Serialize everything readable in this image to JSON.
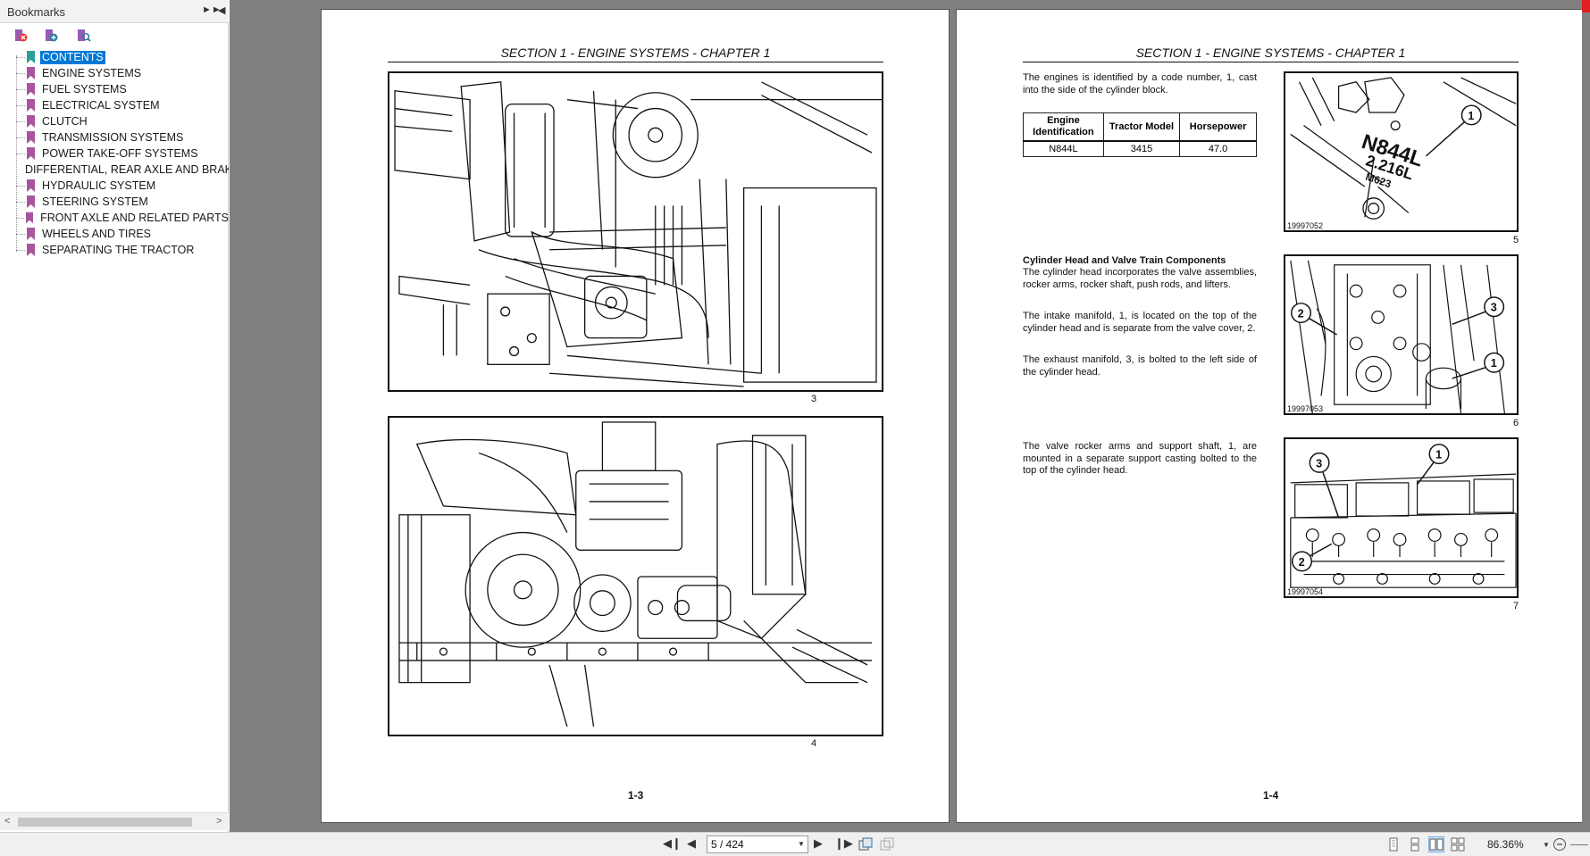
{
  "bookmarks_panel": {
    "title": "Bookmarks",
    "items": [
      {
        "label": "CONTENTS",
        "selected": true
      },
      {
        "label": "ENGINE SYSTEMS"
      },
      {
        "label": "FUEL SYSTEMS"
      },
      {
        "label": "ELECTRICAL SYSTEM"
      },
      {
        "label": "CLUTCH"
      },
      {
        "label": "TRANSMISSION SYSTEMS"
      },
      {
        "label": "POWER TAKE-OFF SYSTEMS"
      },
      {
        "label": "DIFFERENTIAL, REAR AXLE AND BRAK"
      },
      {
        "label": "HYDRAULIC SYSTEM"
      },
      {
        "label": "STEERING SYSTEM"
      },
      {
        "label": "FRONT AXLE AND RELATED PARTS"
      },
      {
        "label": "WHEELS AND TIRES"
      },
      {
        "label": "SEPARATING THE TRACTOR"
      }
    ]
  },
  "left_page": {
    "header": "SECTION 1 - ENGINE SYSTEMS - CHAPTER 1",
    "fig3_number": "3",
    "fig4_number": "4",
    "footer": "1-3"
  },
  "right_page": {
    "header": "SECTION 1 - ENGINE SYSTEMS - CHAPTER 1",
    "intro_text": "The engines is identified by a code number, 1, cast into the side of the cylinder block.",
    "table": {
      "headers": [
        "Engine Identification",
        "Tractor Model",
        "Horsepower"
      ],
      "row": [
        "N844L",
        "3415",
        "47.0"
      ]
    },
    "fig5": {
      "number": "5",
      "id": "19997052",
      "callout": "1",
      "stamp_line1": "N844L",
      "stamp_line2": "2.216L",
      "stamp_line3": "M623"
    },
    "cyl_heading": "Cylinder Head and Valve Train Components",
    "cyl_p1": "The cylinder head incorporates the valve assemblies, rocker arms, rocker shaft, push rods, and lifters.",
    "cyl_p2": "The intake manifold, 1, is located on the top of the cylinder head and is separate from the valve cover, 2.",
    "cyl_p3": "The exhaust manifold, 3, is bolted to the left side of the cylinder head.",
    "fig6": {
      "number": "6",
      "id": "19997053",
      "callouts": [
        "2",
        "3",
        "1"
      ]
    },
    "rocker_text": "The valve rocker arms and support shaft, 1, are mounted in a separate support casting bolted to the top of the cylinder head.",
    "fig7": {
      "number": "7",
      "id": "19997054",
      "callouts": [
        "3",
        "1",
        "2"
      ]
    },
    "footer": "1-4"
  },
  "toolbar": {
    "page_value": "5 / 424",
    "zoom": "86.36%"
  },
  "icons": [
    "expand-panel-icon",
    "collapse-panel-icon",
    "bookmark-delete-icon",
    "bookmark-add-icon",
    "bookmark-find-icon",
    "first-page-icon",
    "prev-page-icon",
    "next-page-icon",
    "last-page-icon",
    "single-page-view-icon",
    "continuous-view-icon",
    "facing-view-icon",
    "continuous-facing-view-icon",
    "zoom-out-icon"
  ]
}
